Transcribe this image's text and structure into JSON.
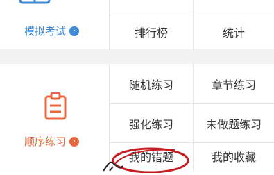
{
  "colors": {
    "mock_blue": "#3e8ad6",
    "order_orange": "#e9663f",
    "annotation_red": "#c71b22",
    "divider": "#e6e6e6",
    "section_gap": "#f2f2f2"
  },
  "sections": [
    {
      "icon": "book-icon",
      "label": "模拟考试",
      "arrow_icon": "chevron-right-icon",
      "items": [
        "",
        "",
        "排行榜",
        "统计"
      ]
    },
    {
      "icon": "clipboard-icon",
      "label": "顺序练习",
      "arrow_icon": "chevron-right-icon",
      "items": [
        "随机练习",
        "章节练习",
        "强化练习",
        "未做题练习",
        "我的错题",
        "我的收藏"
      ]
    }
  ],
  "annotation": {
    "highlighted_item": "我的错题",
    "shape": "red-ellipse-circle",
    "pointer": "hand-cursor-icon"
  }
}
